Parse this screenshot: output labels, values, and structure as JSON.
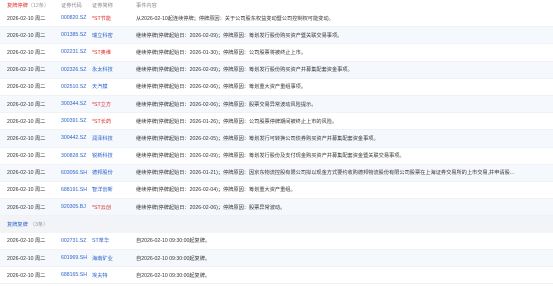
{
  "header": {
    "group_label": "复牌停牌",
    "group_count": "（12条）",
    "col_code": "证券代码",
    "col_name": "证券简称",
    "col_event": "事件内容"
  },
  "suspensions": [
    {
      "date": "2026-02-10 周二",
      "code": "000820.SZ",
      "name": "*ST节能",
      "event": "从2026-02-10起连续停牌；停牌原因：关于公司股东权益变动暨公司控制权可能变动。",
      "color": "red"
    },
    {
      "date": "2026-02-10 周二",
      "code": "001385.SZ",
      "name": "瑞立科密",
      "event": "继续停牌(停牌起始日：2026-02-09)；停牌原因：筹划发行股份购买资产暨关联交易事项。",
      "color": "blue"
    },
    {
      "date": "2026-02-10 周二",
      "code": "002231.SZ",
      "name": "*ST奥维",
      "event": "继续停牌(停牌起始日：2026-01-30)；停牌原因：公司股票将被终止上市。",
      "color": "red"
    },
    {
      "date": "2026-02-10 周二",
      "code": "002326.SZ",
      "name": "永太科技",
      "event": "继续停牌(停牌起始日：2026-02-09)；停牌原因：筹划发行股份购买资产并募集配套资金事项。",
      "color": "blue"
    },
    {
      "date": "2026-02-10 周二",
      "code": "002510.SZ",
      "name": "天汽模",
      "event": "继续停牌(停牌起始日：2026-02-06)；停牌原因：筹划重大资产重组事项。",
      "color": "blue"
    },
    {
      "date": "2026-02-10 周二",
      "code": "300344.SZ",
      "name": "*ST立方",
      "event": "继续停牌(停牌起始日：2026-02-06)；停牌原因：股票交易异常波动风险提示。",
      "color": "red"
    },
    {
      "date": "2026-02-10 周二",
      "code": "300391.SZ",
      "name": "*ST长药",
      "event": "继续停牌(停牌起始日：2026-01-26)；停牌原因：公司股票停牌期间被终止上市的风险。",
      "color": "red"
    },
    {
      "date": "2026-02-10 周二",
      "code": "300442.SZ",
      "name": "润泽科技",
      "event": "继续停牌(停牌起始日：2026-02-05)；停牌原因：筹划发行可转换公司债券购买资产并募集配套资金事项。",
      "color": "blue"
    },
    {
      "date": "2026-02-10 周二",
      "code": "300828.SZ",
      "name": "锐新科技",
      "event": "继续停牌(停牌起始日：2026-02-09)；停牌原因：筹划发行股份及支付现金购买资产并募集配套资金暨关联交易事项。",
      "color": "blue"
    },
    {
      "date": "2026-02-10 周二",
      "code": "603056.SH",
      "name": "德邦股份",
      "event": "继续停牌(停牌起始日：2026-01-21)；停牌原因：因京东物流控股有限公司拟以现金方式要约收购德邦物流股份有限公司股票在上海证券交易所的上市交易,并申请股...",
      "color": "blue"
    },
    {
      "date": "2026-02-10 周二",
      "code": "688191.SH",
      "name": "智洋创新",
      "event": "继续停牌(停牌起始日：2026-02-04)；停牌原因：筹划重大资产重组。",
      "color": "blue"
    },
    {
      "date": "2026-02-10 周二",
      "code": "920305.BJ",
      "name": "*ST云创",
      "event": "继续停牌(停牌起始日：2026-02-06)；停牌原因：股票异常波动。",
      "color": "red"
    }
  ],
  "resume_section": {
    "title": "复牌复牌",
    "count": "（3条）"
  },
  "resumptions": [
    {
      "date": "2026-02-10 周二",
      "code": "002731.SZ",
      "name": "ST萃华",
      "event": "自2026-02-10 09:30:00起复牌。",
      "color": "blue"
    },
    {
      "date": "2026-02-10 周二",
      "code": "601969.SH",
      "name": "海南矿业",
      "event": "自2026-02-10 09:30:00起复牌。",
      "color": "blue"
    },
    {
      "date": "2026-02-10 周二",
      "code": "688165.SH",
      "name": "埃夫特",
      "event": "自2026-02-10 09:30:00起复牌。",
      "color": "blue"
    }
  ]
}
